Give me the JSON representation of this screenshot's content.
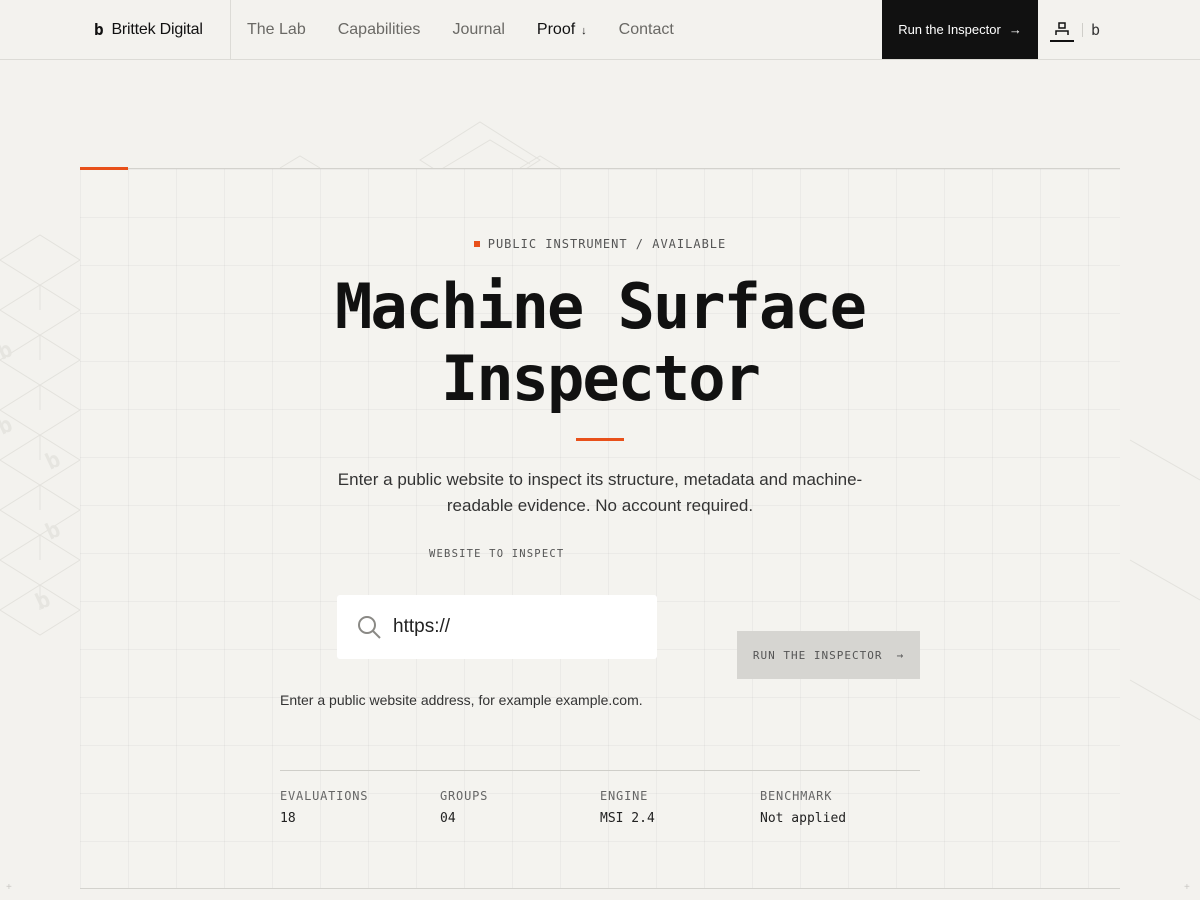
{
  "brand": {
    "mark": "b",
    "name": "Brittek Digital"
  },
  "nav": {
    "links": [
      "The Lab",
      "Capabilities",
      "Journal",
      "Proof",
      "Contact"
    ],
    "proof_arrow": "↓",
    "cta_label": "Run the Inspector",
    "cta_arrow": "→",
    "secondary_icon": "b"
  },
  "hero": {
    "eyebrow": "PUBLIC INSTRUMENT / AVAILABLE",
    "title_line1": "Machine Surface",
    "title_line2": "Inspector",
    "subtitle": "Enter a public website to inspect its structure, metadata and machine-readable evidence. No account required."
  },
  "form": {
    "label": "WEBSITE TO INSPECT",
    "input_value": "https://",
    "button_label": "RUN THE INSPECTOR",
    "button_arrow": "→",
    "helper": "Enter a public website address, for example example.com."
  },
  "stats": [
    {
      "label": "EVALUATIONS",
      "value": "18"
    },
    {
      "label": "GROUPS",
      "value": "04"
    },
    {
      "label": "ENGINE",
      "value": "MSI 2.4"
    },
    {
      "label": "BENCHMARK",
      "value": "Not applied"
    }
  ],
  "colors": {
    "accent": "#e8501a",
    "background": "#f3f2ee",
    "ink": "#111111",
    "button_disabled": "#d6d5d1"
  }
}
